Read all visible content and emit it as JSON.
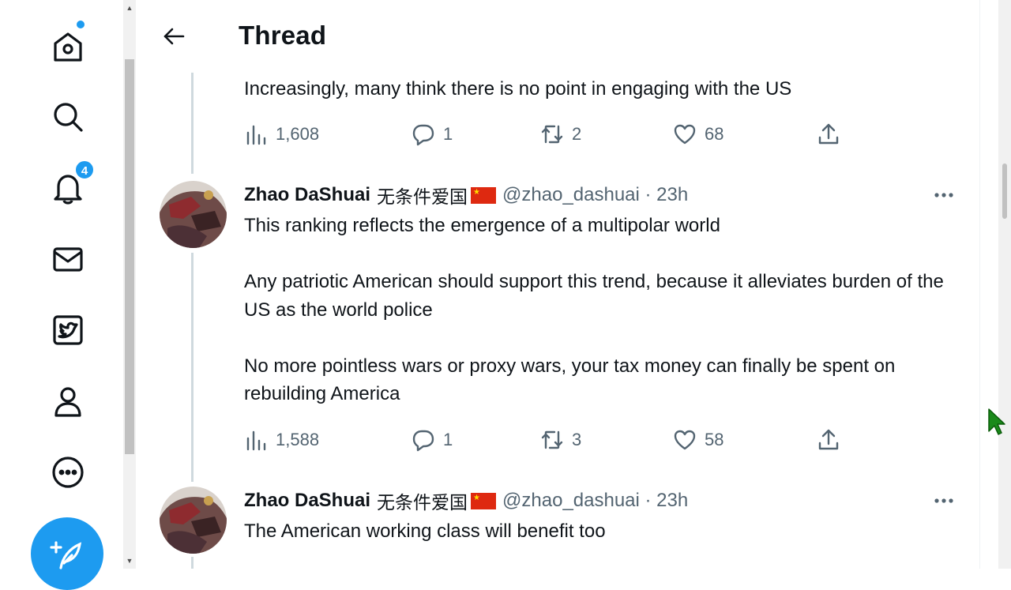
{
  "nav": {
    "items": [
      {
        "icon": "home-icon"
      },
      {
        "icon": "search-icon"
      },
      {
        "icon": "bell-icon",
        "badge": "4"
      },
      {
        "icon": "mail-icon"
      },
      {
        "icon": "twitter-blue-icon"
      },
      {
        "icon": "profile-icon"
      },
      {
        "icon": "more-circle-icon"
      }
    ],
    "compose_icon": "compose-tweet-icon"
  },
  "header": {
    "title": "Thread"
  },
  "tweets": [
    {
      "text": "Increasingly, many think there is no point in engaging with the US",
      "views": "1,608",
      "replies": "1",
      "retweets": "2",
      "likes": "68"
    },
    {
      "name": "Zhao DaShuai",
      "name_cjk": "无条件爱国",
      "handle": "@zhao_dashuai · 23h",
      "text": "This ranking reflects the emergence of a multipolar world\n\nAny patriotic American should support this trend, because it alleviates burden of the US as the world police\n\nNo more pointless wars or proxy wars, your tax money can finally be spent on rebuilding America",
      "views": "1,588",
      "replies": "1",
      "retweets": "3",
      "likes": "58"
    },
    {
      "name": "Zhao DaShuai",
      "name_cjk": "无条件爱国",
      "handle": "@zhao_dashuai · 23h",
      "text": "The American working class will benefit too"
    }
  ],
  "colors": {
    "accent": "#1d9bf0",
    "muted": "#536471",
    "text": "#0f1419"
  }
}
